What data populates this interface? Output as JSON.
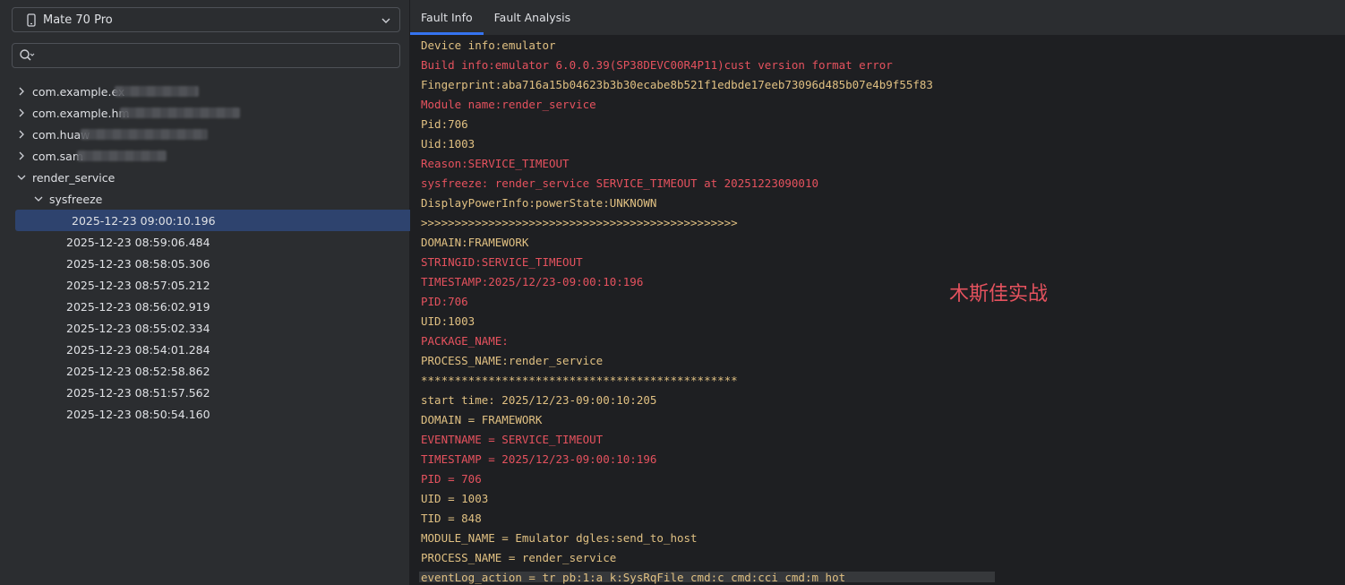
{
  "device": {
    "name": "Mate 70 Pro",
    "icon": "phone-icon"
  },
  "search": {
    "placeholder": "",
    "value": ""
  },
  "tree": {
    "packages": [
      {
        "label": "com.example.ex",
        "expanded": false
      },
      {
        "label": "com.example.hm",
        "expanded": false
      },
      {
        "label": "com.huaw",
        "expanded": false
      },
      {
        "label": "com.sam",
        "expanded": false
      },
      {
        "label": "render_service",
        "expanded": true
      }
    ],
    "group": "sysfreeze",
    "entries": [
      "2025-12-23 09:00:10.196",
      "2025-12-23 08:59:06.484",
      "2025-12-23 08:58:05.306",
      "2025-12-23 08:57:05.212",
      "2025-12-23 08:56:02.919",
      "2025-12-23 08:55:02.334",
      "2025-12-23 08:54:01.284",
      "2025-12-23 08:52:58.862",
      "2025-12-23 08:51:57.562",
      "2025-12-23 08:50:54.160"
    ],
    "selected_index": 0
  },
  "tabs": [
    {
      "label": "Fault Info",
      "active": true
    },
    {
      "label": "Fault Analysis",
      "active": false
    }
  ],
  "log": [
    {
      "text": "Device info:emulator",
      "color": "yellow"
    },
    {
      "text": "Build info:emulator 6.0.0.39(SP38DEVC00R4P11)cust version format error",
      "color": "red"
    },
    {
      "text": "Fingerprint:aba716a15b04623b3b30ecabe8b521f1edbde17eeb73096d485b07e4b9f55f83",
      "color": "yellow"
    },
    {
      "text": "Module name:render_service",
      "color": "red"
    },
    {
      "text": "Pid:706",
      "color": "yellow"
    },
    {
      "text": "Uid:1003",
      "color": "yellow"
    },
    {
      "text": "Reason:SERVICE_TIMEOUT",
      "color": "red"
    },
    {
      "text": "sysfreeze: render_service SERVICE_TIMEOUT at 20251223090010",
      "color": "red"
    },
    {
      "text": "DisplayPowerInfo:powerState:UNKNOWN",
      "color": "yellow"
    },
    {
      "text": ">>>>>>>>>>>>>>>>>>>>>>>>>>>>>>>>>>>>>>>>>>>>>>>",
      "color": "yellow"
    },
    {
      "text": "DOMAIN:FRAMEWORK",
      "color": "yellow"
    },
    {
      "text": "STRINGID:SERVICE_TIMEOUT",
      "color": "red"
    },
    {
      "text": "TIMESTAMP:2025/12/23-09:00:10:196",
      "color": "red"
    },
    {
      "text": "PID:706",
      "color": "red"
    },
    {
      "text": "UID:1003",
      "color": "yellow"
    },
    {
      "text": "PACKAGE_NAME:",
      "color": "red"
    },
    {
      "text": "PROCESS_NAME:render_service",
      "color": "yellow"
    },
    {
      "text": "***********************************************",
      "color": "yellow"
    },
    {
      "text": "start time: 2025/12/23-09:00:10:205",
      "color": "yellow"
    },
    {
      "text": "DOMAIN = FRAMEWORK",
      "color": "yellow"
    },
    {
      "text": "EVENTNAME = SERVICE_TIMEOUT",
      "color": "red"
    },
    {
      "text": "TIMESTAMP = 2025/12/23-09:00:10:196",
      "color": "red"
    },
    {
      "text": "PID = 706",
      "color": "red"
    },
    {
      "text": "UID = 1003",
      "color": "yellow"
    },
    {
      "text": "TID = 848",
      "color": "yellow"
    },
    {
      "text": "MODULE_NAME = Emulator dgles:send_to_host",
      "color": "yellow"
    },
    {
      "text": "PROCESS_NAME = render_service",
      "color": "yellow"
    },
    {
      "text": "eventLog_action = tr pb:1:a k:SysRqFile cmd:c cmd:cci cmd:m hot",
      "color": "yellow"
    }
  ],
  "watermark": "木斯佳实战",
  "colors": {
    "accent": "#3574f0",
    "log_yellow": "#e0c082",
    "log_red": "#e5525e",
    "selection": "#2e436e"
  }
}
